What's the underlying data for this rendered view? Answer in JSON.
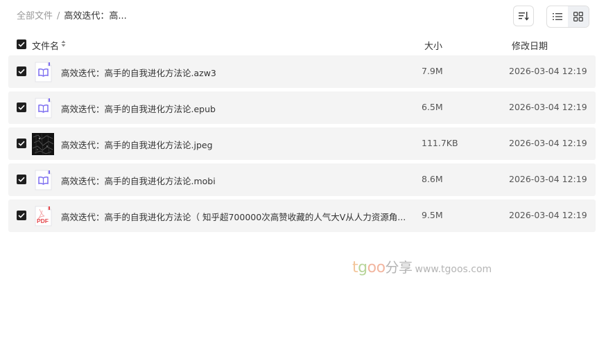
{
  "breadcrumb": {
    "root": "全部文件",
    "separator": "/",
    "current": "高效迭代：高..."
  },
  "toolbar": {
    "sort_icon": "sort-lines-icon",
    "list_view_icon": "list-view-icon",
    "grid_view_icon": "grid-view-icon",
    "active_view": "grid"
  },
  "table": {
    "headers": {
      "name": "文件名",
      "size": "大小",
      "date": "修改日期"
    },
    "rows": [
      {
        "name": "高效迭代：高手的自我进化方法论.azw3",
        "size": "7.9M",
        "date": "2026-03-04 12:19",
        "icon": "ebook-icon",
        "checked": true
      },
      {
        "name": "高效迭代：高手的自我进化方法论.epub",
        "size": "6.5M",
        "date": "2026-03-04 12:19",
        "icon": "ebook-icon",
        "checked": true
      },
      {
        "name": "高效迭代：高手的自我进化方法论.jpeg",
        "size": "111.7KB",
        "date": "2026-03-04 12:19",
        "icon": "image-thumbnail",
        "checked": true
      },
      {
        "name": "高效迭代：高手的自我进化方法论.mobi",
        "size": "8.6M",
        "date": "2026-03-04 12:19",
        "icon": "ebook-icon",
        "checked": true
      },
      {
        "name": "高效迭代：高手的自我进化方法论（ 知乎超700000次高赞收藏的人气大V从人力资源角...",
        "size": "9.5M",
        "date": "2026-03-04 12:19",
        "icon": "pdf-icon",
        "checked": true
      }
    ]
  },
  "watermark": {
    "brand_t": "t",
    "brand_g": "g",
    "brand_oo": "oo",
    "brand_share": "分享",
    "url": "www.tgoos.com"
  },
  "colors": {
    "row_bg": "#f4f4f4",
    "checkbox": "#1f1f1f",
    "ebook_accent": "#7b6cf0",
    "pdf_accent": "#e5484d"
  }
}
